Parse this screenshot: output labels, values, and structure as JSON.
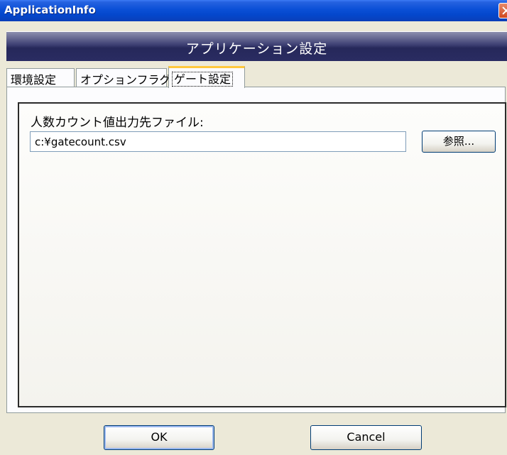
{
  "window": {
    "title": "ApplicationInfo"
  },
  "header": {
    "title": "アプリケーション設定"
  },
  "tabs": [
    {
      "label": "環境設定",
      "active": false
    },
    {
      "label": "オプションフラグ",
      "active": false
    },
    {
      "label": "ゲート設定",
      "active": true
    }
  ],
  "gate_settings": {
    "output_file_label": "人数カウント値出力先ファイル:",
    "output_file_value": "c:¥gatecount.csv",
    "browse_label": "参照..."
  },
  "footer": {
    "ok_label": "OK",
    "cancel_label": "Cancel"
  },
  "colors": {
    "titlebar": "#0a4fd6",
    "header_banner": "#2a2c62",
    "active_tab_accent": "#ffc83c",
    "window_bg": "#ece9d8"
  }
}
